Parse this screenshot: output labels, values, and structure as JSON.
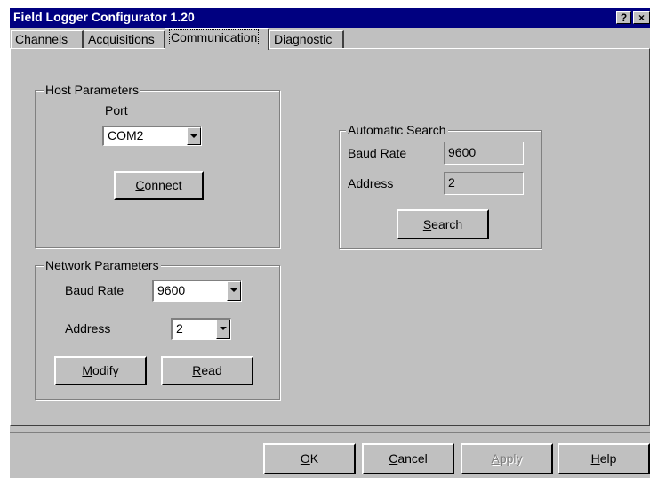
{
  "window": {
    "title": "Field Logger Configurator 1.20",
    "help_icon": "?",
    "close_icon": "×"
  },
  "tabs": [
    {
      "label": "Channels"
    },
    {
      "label": "Acquisitions"
    },
    {
      "label": "Communication",
      "active": true
    },
    {
      "label": "Diagnostic"
    }
  ],
  "host_parameters": {
    "title": "Host Parameters",
    "port_label": "Port",
    "port_value": "COM2",
    "connect_prefix": "",
    "connect_accel": "C",
    "connect_rest": "onnect"
  },
  "network_parameters": {
    "title": "Network Parameters",
    "baud_rate_label": "Baud Rate",
    "baud_rate_value": "9600",
    "address_label": "Address",
    "address_value": "2",
    "modify_accel": "M",
    "modify_rest": "odify",
    "read_accel": "R",
    "read_rest": "ead"
  },
  "automatic_search": {
    "title": "Automatic Search",
    "baud_rate_label": "Baud Rate",
    "baud_rate_value": "9600",
    "address_label": "Address",
    "address_value": "2",
    "search_accel": "S",
    "search_rest": "earch"
  },
  "footer": {
    "ok_accel": "O",
    "ok_rest": "K",
    "cancel_accel": "C",
    "cancel_rest": "ancel",
    "apply_accel": "A",
    "apply_rest": "pply",
    "help_accel": "H",
    "help_rest": "elp"
  },
  "colors": {
    "face": "#c0c0c0",
    "titlebar": "#000080",
    "shadow": "#808080",
    "highlight": "#ffffff"
  }
}
